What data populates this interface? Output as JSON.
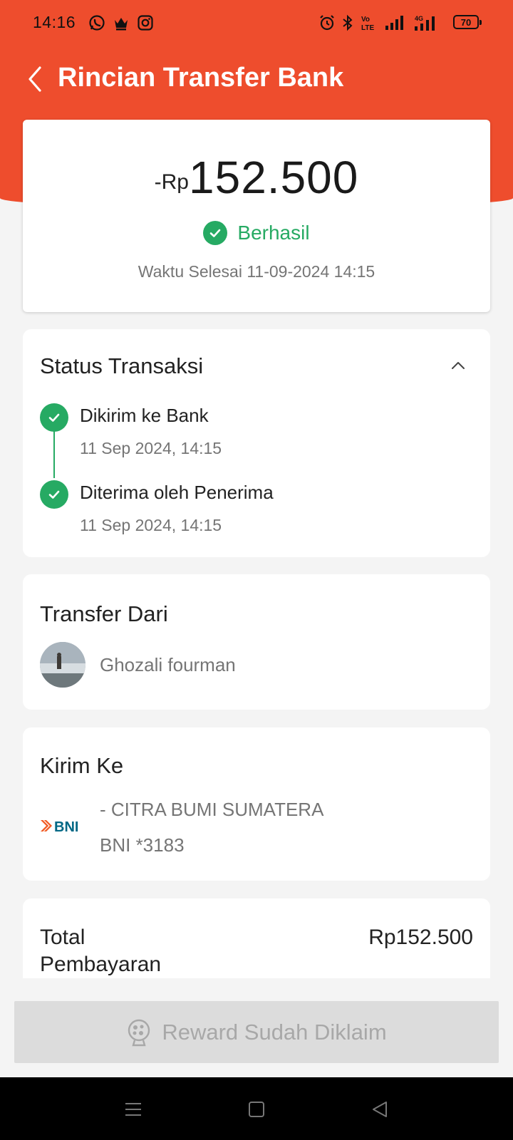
{
  "status_bar": {
    "time": "14:16",
    "battery": "70",
    "icons": [
      "whatsapp-icon",
      "crown-icon",
      "instagram-icon",
      "alarm-icon",
      "bluetooth-icon",
      "volte-icon",
      "signal-icon",
      "4g-signal-icon"
    ]
  },
  "header": {
    "title": "Rincian Transfer Bank",
    "background_color": "#ee4d2d"
  },
  "summary": {
    "amount_prefix": "-Rp",
    "amount": "152.500",
    "status": "Berhasil",
    "status_color": "#26aa63",
    "finish_time": "Waktu Selesai 11-09-2024 14:15"
  },
  "transaction_status": {
    "title": "Status Transaksi",
    "steps": [
      {
        "title": "Dikirim ke Bank",
        "time": "11 Sep 2024, 14:15"
      },
      {
        "title": "Diterima oleh Penerima",
        "time": "11 Sep 2024, 14:15"
      }
    ]
  },
  "from": {
    "title": "Transfer Dari",
    "name": "Ghozali fourman"
  },
  "to": {
    "title": "Kirim Ke",
    "bank_logo_text": "BNI",
    "name": "- CITRA BUMI SUMATERA",
    "account": "BNI *3183"
  },
  "total": {
    "label": "Total Pembayaran",
    "value": "Rp152.500"
  },
  "reward_button": {
    "label": "Reward Sudah Diklaim"
  }
}
